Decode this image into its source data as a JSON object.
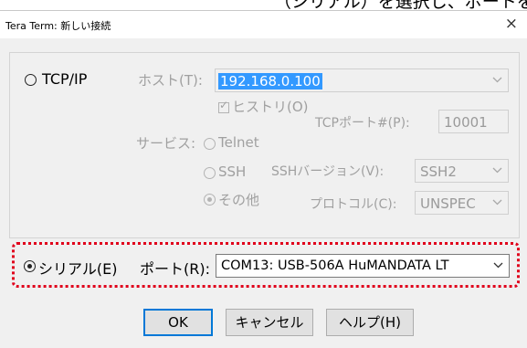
{
  "background_caption": "（シリアル）を選択し、ポートを選",
  "window": {
    "title": "Tera Term: 新しい接続",
    "close_glyph": "×"
  },
  "tcpip": {
    "radio_label": "TCP/IP",
    "host_label": "ホスト(T):",
    "host_value": "192.168.0.100",
    "history_label": "ヒストリ(O)",
    "service_label": "サービス:",
    "telnet_label": "Telnet",
    "ssh_label": "SSH",
    "other_label": "その他",
    "tcp_port_label": "TCPポート#(P):",
    "tcp_port_value": "10001",
    "ssh_version_label": "SSHバージョン(V):",
    "ssh_version_value": "SSH2",
    "protocol_label": "プロトコル(C):",
    "protocol_value": "UNSPEC"
  },
  "serial": {
    "radio_label": "シリアル(E)",
    "port_label": "ポート(R):",
    "port_value": "COM13: USB-506A HuMANDATA LT"
  },
  "buttons": {
    "ok": "OK",
    "cancel": "キャンセル",
    "help": "ヘルプ(H)"
  },
  "colors": {
    "highlight_box": "#e0001b",
    "selection": "#3399ff",
    "default_button_border": "#0078d7"
  },
  "icons": {
    "close": "close-icon",
    "dropdown": "chevron-down-icon"
  }
}
